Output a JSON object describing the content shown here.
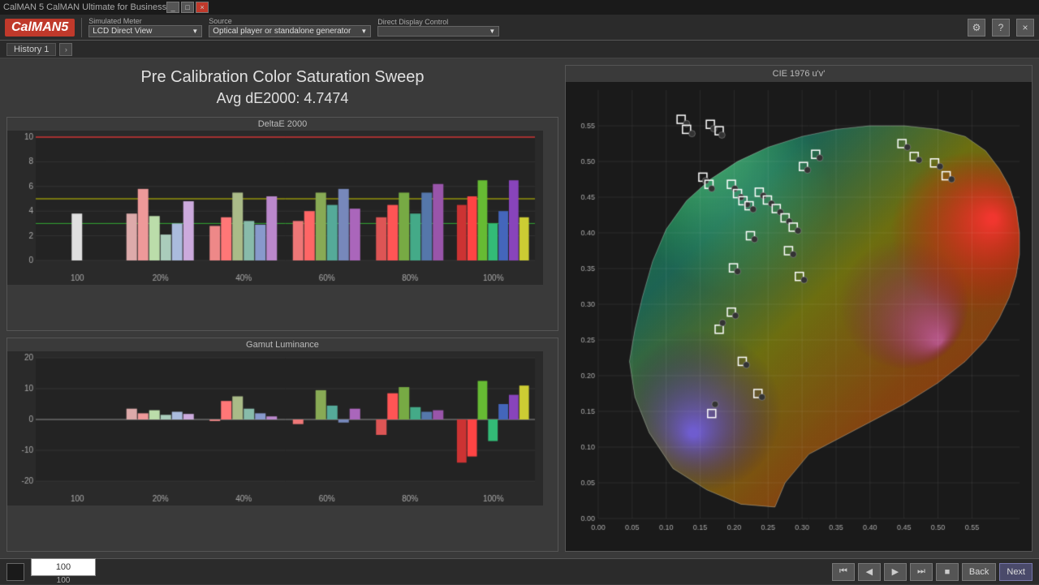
{
  "titlebar": {
    "title": "CalMAN 5 CalMAN Ultimate for Business",
    "buttons": [
      "_",
      "□",
      "×"
    ]
  },
  "toolbar": {
    "logo": "CalMAN5",
    "simulated_meter_label": "Simulated Meter",
    "simulated_meter_value": "LCD Direct View",
    "source_label": "Source",
    "source_value": "Optical player or standalone generator",
    "display_label": "Direct Display Control",
    "display_value": ""
  },
  "history": {
    "tab_label": "History 1",
    "nav_prev": "<",
    "nav_next": ">"
  },
  "page": {
    "title": "Pre Calibration Color Saturation Sweep",
    "avg_de_label": "Avg dE2000:",
    "avg_de_value": "4.7474"
  },
  "deltae_chart": {
    "title": "DeltaE 2000",
    "y_max": 10,
    "y_labels": [
      "0",
      "2",
      "4",
      "6",
      "8",
      "10"
    ],
    "x_labels": [
      "100",
      "20%",
      "40%",
      "60%",
      "80%",
      "100%"
    ],
    "red_line": 10,
    "yellow_line": 5,
    "green_line": 3
  },
  "gamut_chart": {
    "title": "Gamut Luminance",
    "y_labels": [
      "-20",
      "-10",
      "0",
      "10",
      "20"
    ],
    "x_labels": [
      "100",
      "20%",
      "40%",
      "60%",
      "80%",
      "100%"
    ]
  },
  "cie_diagram": {
    "title": "CIE 1976 u'v'",
    "x_labels": [
      "0",
      "0.05",
      "0.1",
      "0.15",
      "0.2",
      "0.25",
      "0.3",
      "0.35",
      "0.4",
      "0.45",
      "0.5",
      "0.55"
    ],
    "y_labels": [
      "0",
      "0.05",
      "0.1",
      "0.15",
      "0.2",
      "0.25",
      "0.3",
      "0.35",
      "0.4",
      "0.45",
      "0.5",
      "0.55"
    ]
  },
  "bottom": {
    "value": "100",
    "nav": {
      "back_label": "Back",
      "next_label": "Next"
    }
  }
}
